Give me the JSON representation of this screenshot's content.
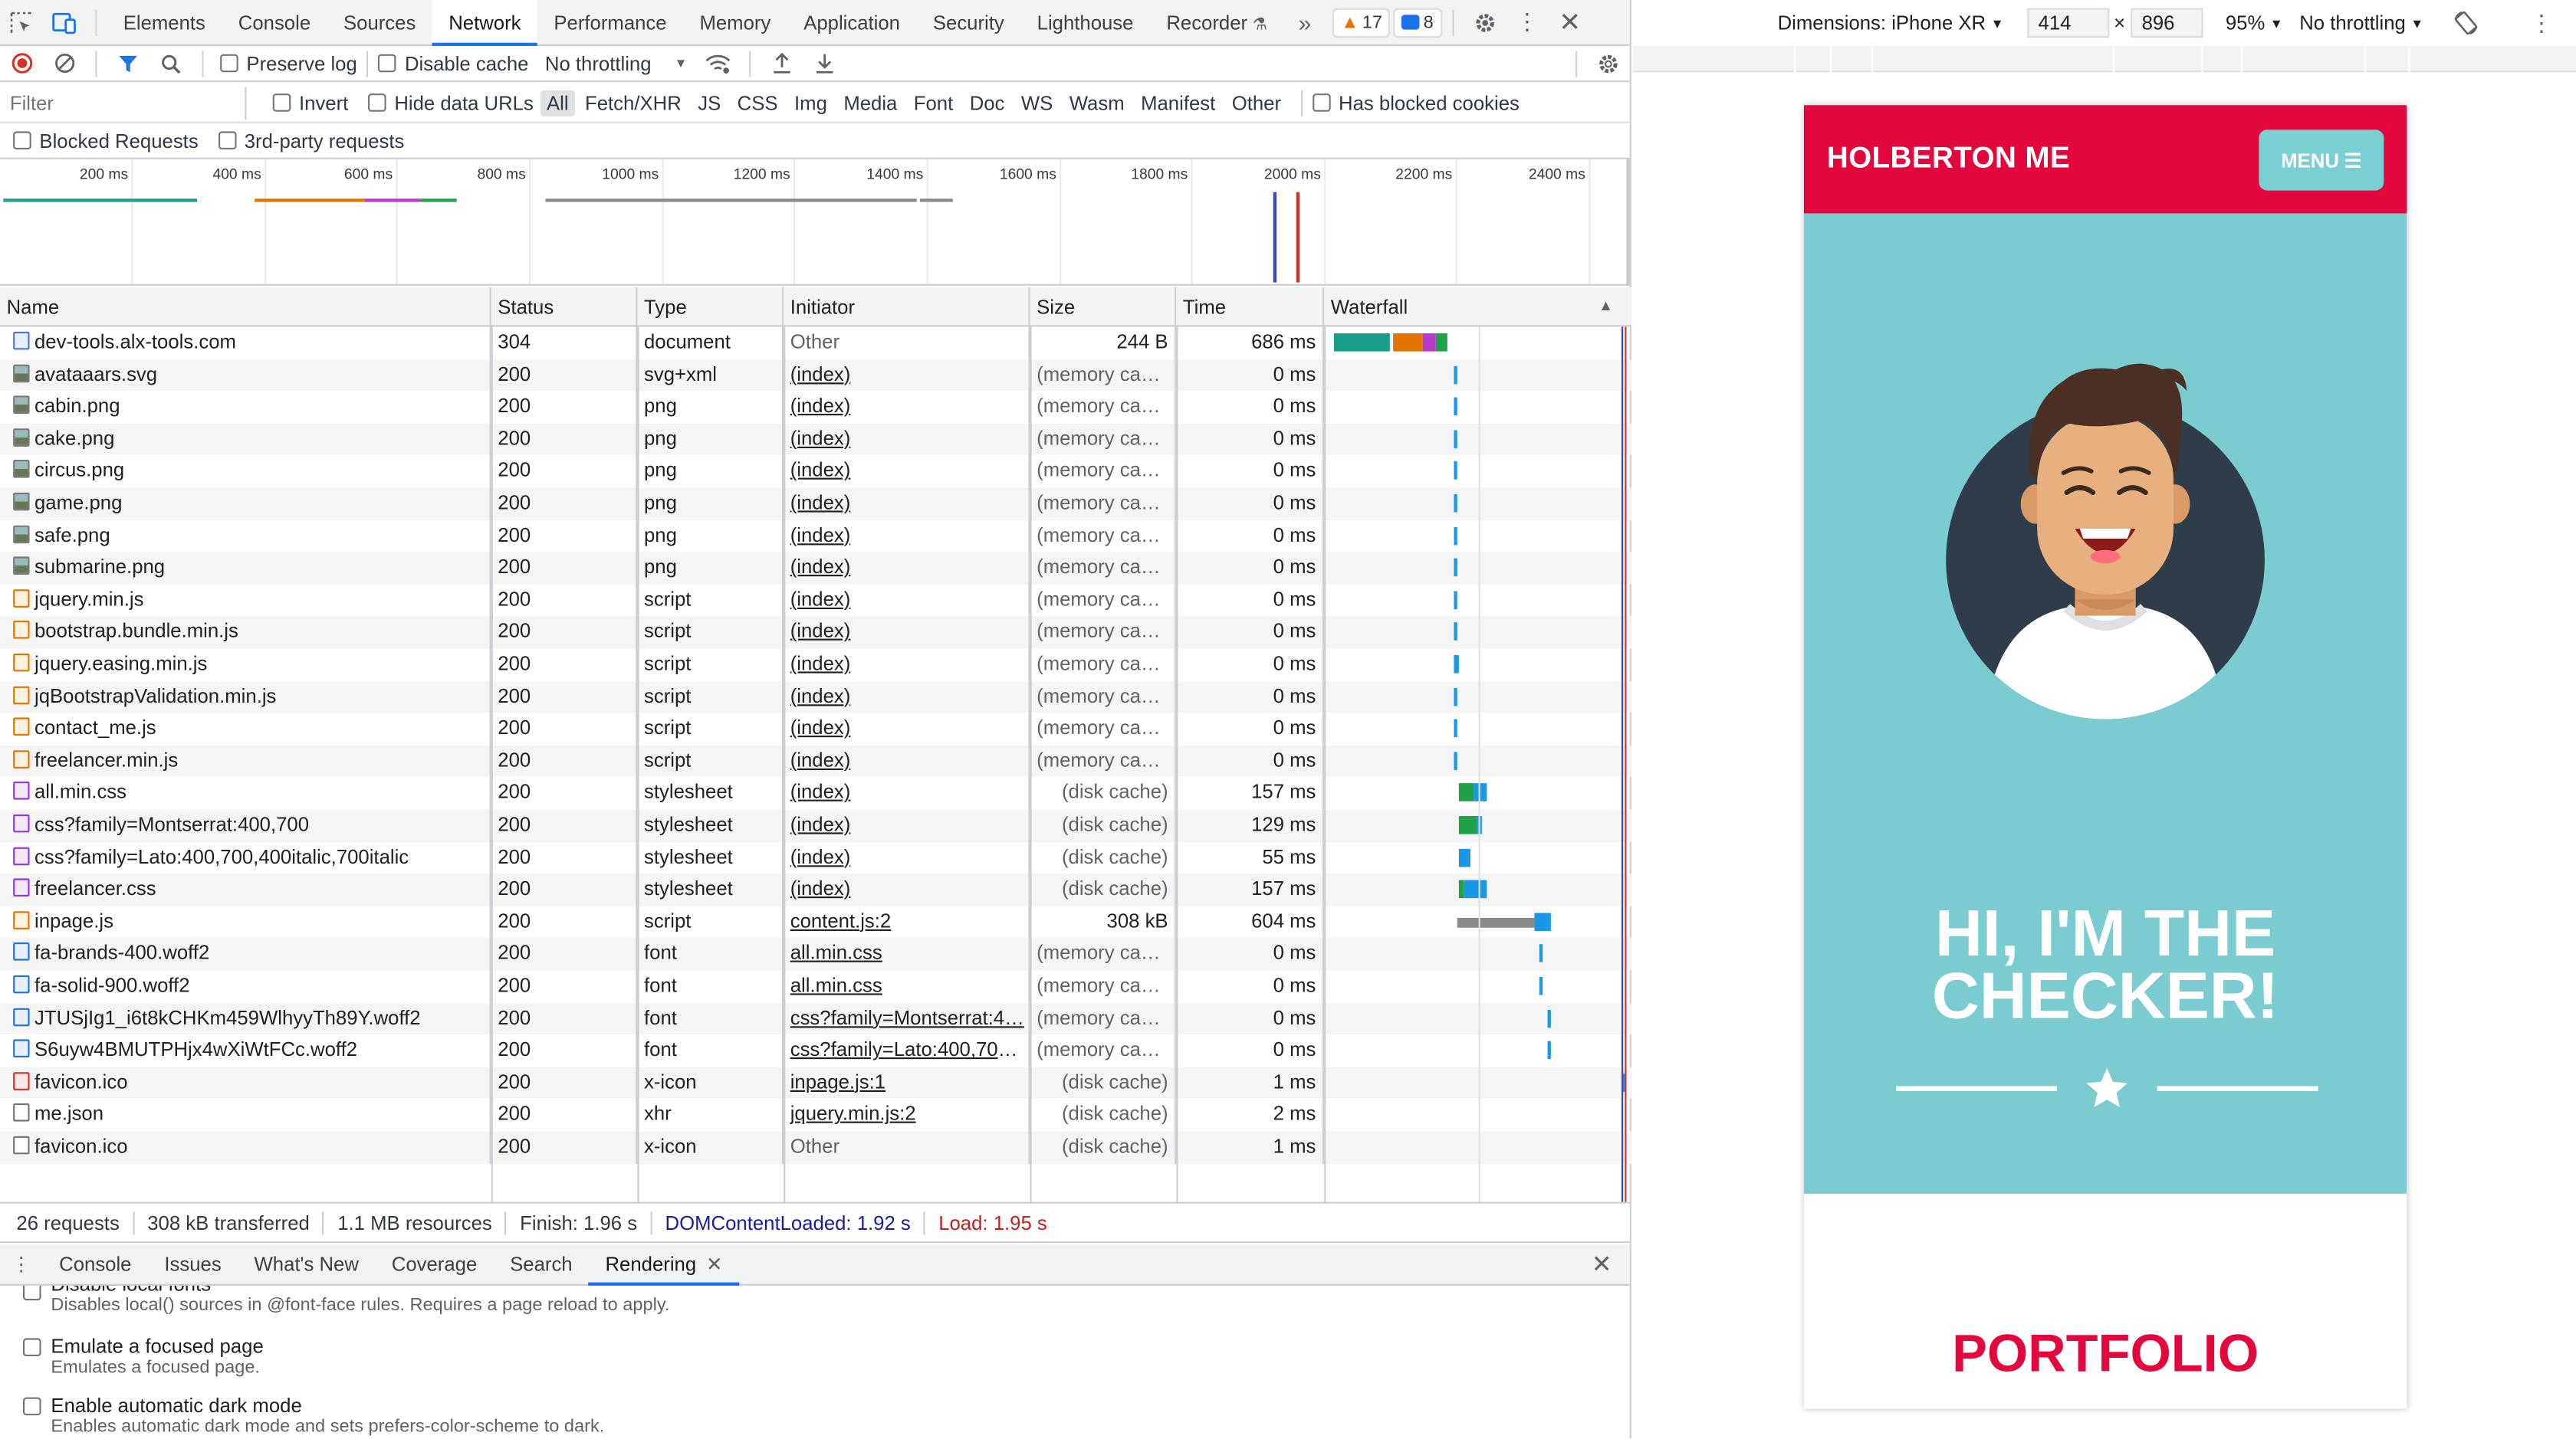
{
  "devtools": {
    "panel_tabs": [
      "Elements",
      "Console",
      "Sources",
      "Network",
      "Performance",
      "Memory",
      "Application",
      "Security",
      "Lighthouse",
      "Recorder"
    ],
    "active_panel": "Network",
    "warnings_count": "17",
    "messages_count": "8",
    "toolbar": {
      "preserve_log": "Preserve log",
      "disable_cache": "Disable cache",
      "throttling": "No throttling"
    },
    "filter": {
      "placeholder": "Filter",
      "invert": "Invert",
      "hide_data_urls": "Hide data URLs",
      "types": [
        "All",
        "Fetch/XHR",
        "JS",
        "CSS",
        "Img",
        "Media",
        "Font",
        "Doc",
        "WS",
        "Wasm",
        "Manifest",
        "Other"
      ],
      "selected_type": "All",
      "has_blocked_cookies": "Has blocked cookies",
      "blocked_requests": "Blocked Requests",
      "third_party": "3rd-party requests"
    },
    "overview_ticks": [
      "200 ms",
      "400 ms",
      "600 ms",
      "800 ms",
      "1000 ms",
      "1200 ms",
      "1400 ms",
      "1600 ms",
      "1800 ms",
      "2000 ms",
      "2200 ms",
      "2400 ms"
    ],
    "columns": [
      "Name",
      "Status",
      "Type",
      "Initiator",
      "Size",
      "Time",
      "Waterfall"
    ],
    "requests": [
      {
        "name": "dev-tools.alx-tools.com",
        "status": "304",
        "type": "document",
        "initiator": "Other",
        "size": "244 B",
        "time": "686 ms",
        "icon": "doc",
        "init_link": false
      },
      {
        "name": "avataaars.svg",
        "status": "200",
        "type": "svg+xml",
        "initiator": "(index)",
        "size": "(memory cache)",
        "time": "0 ms",
        "icon": "img",
        "init_link": true
      },
      {
        "name": "cabin.png",
        "status": "200",
        "type": "png",
        "initiator": "(index)",
        "size": "(memory cache)",
        "time": "0 ms",
        "icon": "img",
        "init_link": true
      },
      {
        "name": "cake.png",
        "status": "200",
        "type": "png",
        "initiator": "(index)",
        "size": "(memory cache)",
        "time": "0 ms",
        "icon": "img",
        "init_link": true
      },
      {
        "name": "circus.png",
        "status": "200",
        "type": "png",
        "initiator": "(index)",
        "size": "(memory cache)",
        "time": "0 ms",
        "icon": "img",
        "init_link": true
      },
      {
        "name": "game.png",
        "status": "200",
        "type": "png",
        "initiator": "(index)",
        "size": "(memory cache)",
        "time": "0 ms",
        "icon": "img",
        "init_link": true
      },
      {
        "name": "safe.png",
        "status": "200",
        "type": "png",
        "initiator": "(index)",
        "size": "(memory cache)",
        "time": "0 ms",
        "icon": "img",
        "init_link": true
      },
      {
        "name": "submarine.png",
        "status": "200",
        "type": "png",
        "initiator": "(index)",
        "size": "(memory cache)",
        "time": "0 ms",
        "icon": "img",
        "init_link": true
      },
      {
        "name": "jquery.min.js",
        "status": "200",
        "type": "script",
        "initiator": "(index)",
        "size": "(memory cache)",
        "time": "0 ms",
        "icon": "js",
        "init_link": true
      },
      {
        "name": "bootstrap.bundle.min.js",
        "status": "200",
        "type": "script",
        "initiator": "(index)",
        "size": "(memory cache)",
        "time": "0 ms",
        "icon": "js",
        "init_link": true
      },
      {
        "name": "jquery.easing.min.js",
        "status": "200",
        "type": "script",
        "initiator": "(index)",
        "size": "(memory cache)",
        "time": "0 ms",
        "icon": "js",
        "init_link": true
      },
      {
        "name": "jqBootstrapValidation.min.js",
        "status": "200",
        "type": "script",
        "initiator": "(index)",
        "size": "(memory cache)",
        "time": "0 ms",
        "icon": "js",
        "init_link": true
      },
      {
        "name": "contact_me.js",
        "status": "200",
        "type": "script",
        "initiator": "(index)",
        "size": "(memory cache)",
        "time": "0 ms",
        "icon": "js",
        "init_link": true
      },
      {
        "name": "freelancer.min.js",
        "status": "200",
        "type": "script",
        "initiator": "(index)",
        "size": "(memory cache)",
        "time": "0 ms",
        "icon": "js",
        "init_link": true
      },
      {
        "name": "all.min.css",
        "status": "200",
        "type": "stylesheet",
        "initiator": "(index)",
        "size": "(disk cache)",
        "time": "157 ms",
        "icon": "css",
        "init_link": true
      },
      {
        "name": "css?family=Montserrat:400,700",
        "status": "200",
        "type": "stylesheet",
        "initiator": "(index)",
        "size": "(disk cache)",
        "time": "129 ms",
        "icon": "css",
        "init_link": true
      },
      {
        "name": "css?family=Lato:400,700,400italic,700italic",
        "status": "200",
        "type": "stylesheet",
        "initiator": "(index)",
        "size": "(disk cache)",
        "time": "55 ms",
        "icon": "css",
        "init_link": true
      },
      {
        "name": "freelancer.css",
        "status": "200",
        "type": "stylesheet",
        "initiator": "(index)",
        "size": "(disk cache)",
        "time": "157 ms",
        "icon": "css",
        "init_link": true
      },
      {
        "name": "inpage.js",
        "status": "200",
        "type": "script",
        "initiator": "content.js:2",
        "size": "308 kB",
        "time": "604 ms",
        "icon": "js",
        "init_link": true
      },
      {
        "name": "fa-brands-400.woff2",
        "status": "200",
        "type": "font",
        "initiator": "all.min.css",
        "size": "(memory cache)",
        "time": "0 ms",
        "icon": "font",
        "init_link": true
      },
      {
        "name": "fa-solid-900.woff2",
        "status": "200",
        "type": "font",
        "initiator": "all.min.css",
        "size": "(memory cache)",
        "time": "0 ms",
        "icon": "font",
        "init_link": true
      },
      {
        "name": "JTUSjIg1_i6t8kCHKm459WlhyyTh89Y.woff2",
        "status": "200",
        "type": "font",
        "initiator": "css?family=Montserrat:4…",
        "size": "(memory cache)",
        "time": "0 ms",
        "icon": "font",
        "init_link": true
      },
      {
        "name": "S6uyw4BMUTPHjx4wXiWtFCc.woff2",
        "status": "200",
        "type": "font",
        "initiator": "css?family=Lato:400,700,…",
        "size": "(memory cache)",
        "time": "0 ms",
        "icon": "font",
        "init_link": true
      },
      {
        "name": "favicon.ico",
        "status": "200",
        "type": "x-icon",
        "initiator": "inpage.js:1",
        "size": "(disk cache)",
        "time": "1 ms",
        "icon": "ico",
        "init_link": true
      },
      {
        "name": "me.json",
        "status": "200",
        "type": "xhr",
        "initiator": "jquery.min.js:2",
        "size": "(disk cache)",
        "time": "2 ms",
        "icon": "blank",
        "init_link": true
      },
      {
        "name": "favicon.ico",
        "status": "200",
        "type": "x-icon",
        "initiator": "Other",
        "size": "(disk cache)",
        "time": "1 ms",
        "icon": "blank",
        "init_link": false
      }
    ],
    "status_bar": {
      "requests": "26 requests",
      "transferred": "308 kB transferred",
      "resources": "1.1 MB resources",
      "finish": "Finish: 1.96 s",
      "dcl": "DOMContentLoaded: 1.92 s",
      "load": "Load: 1.95 s"
    },
    "drawer_tabs": [
      "Console",
      "Issues",
      "What's New",
      "Coverage",
      "Search",
      "Rendering"
    ],
    "active_drawer_tab": "Rendering",
    "rendering_options": [
      {
        "title": "Disable local fonts",
        "desc": "Disables local() sources in @font-face rules. Requires a page reload to apply."
      },
      {
        "title": "Emulate a focused page",
        "desc": "Emulates a focused page."
      },
      {
        "title": "Enable automatic dark mode",
        "desc": "Enables automatic dark mode and sets prefers-color-scheme to dark."
      }
    ]
  },
  "device_toolbar": {
    "dimensions_label": "Dimensions: iPhone XR",
    "width": "414",
    "times": "×",
    "height": "896",
    "zoom": "95%",
    "throttling": "No throttling"
  },
  "site": {
    "brand": "HOLBERTON ME",
    "menu": "MENU",
    "headline_line1": "HI, I'M THE",
    "headline_line2": "CHECKER!",
    "portfolio": "PORTFOLIO",
    "colors": {
      "primary": "#e2083d",
      "hero": "#7accd1",
      "menu": "#7acfd3"
    }
  }
}
